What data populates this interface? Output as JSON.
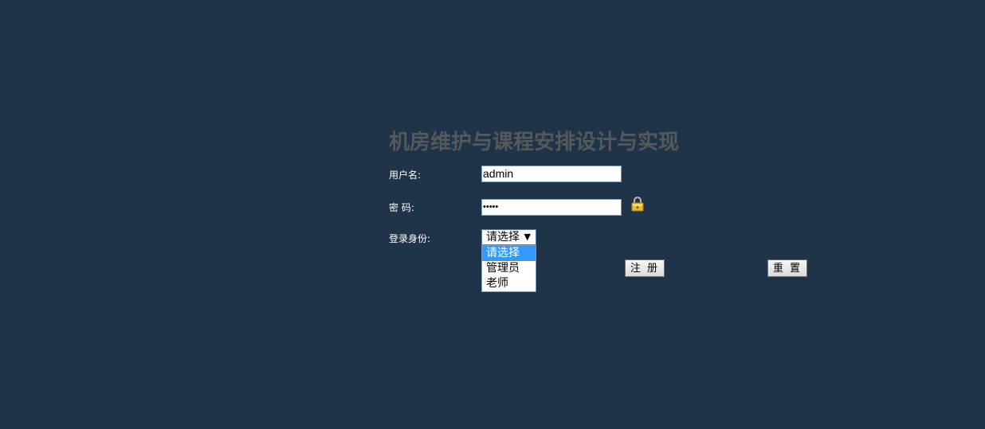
{
  "title": "机房维护与课程安排设计与实现",
  "form": {
    "username_label": "用户名:",
    "username_value": "admin",
    "password_label": "密 码:",
    "password_value": "•••••",
    "role_label": "登录身份:",
    "role_selected": "请选择",
    "role_options": [
      "请选择",
      "管理员",
      "老师"
    ],
    "register_label": "注 册",
    "reset_label": "重 置"
  },
  "colors": {
    "background": "#1f3449",
    "title": "#56595c",
    "option_highlight": "#3399ff"
  },
  "icons": {
    "password_hint": "lock-icon",
    "select_arrow": "dropdown-arrow-icon"
  }
}
